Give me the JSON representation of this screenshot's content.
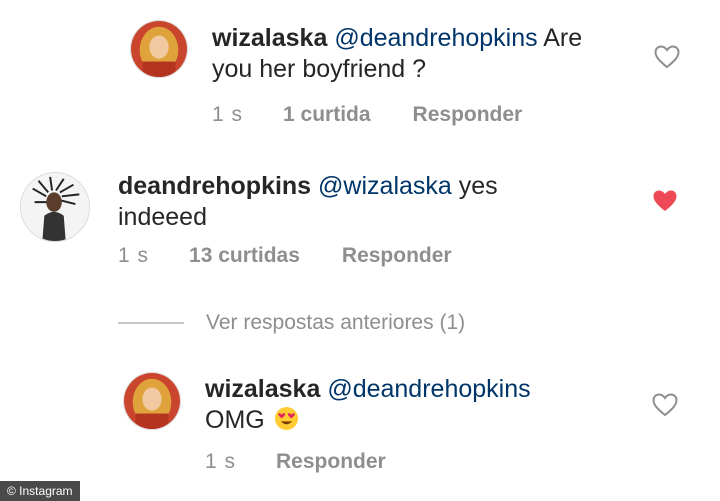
{
  "comments": [
    {
      "username": "wizalaska",
      "mention": "@deandrehopkins",
      "text_line1": "Are",
      "text_line2": "you her boyfriend ?",
      "time": "1 s",
      "likes": "1 curtida",
      "reply": "Responder",
      "liked": false
    },
    {
      "username": "deandrehopkins",
      "mention": "@wizalaska",
      "text_line1": "yes",
      "text_line2": "indeeed",
      "time": "1 s",
      "likes": "13 curtidas",
      "reply": "Responder",
      "liked": true
    },
    {
      "username": "wizalaska",
      "mention": "@deandrehopkins",
      "text_line2": "OMG",
      "emoji": "heart-eyes-emoji",
      "time": "1 s",
      "reply": "Responder",
      "liked": false
    }
  ],
  "view_previous": "Ver respostas anteriores (1)",
  "watermark": "© Instagram",
  "colors": {
    "liked_heart": "#ed4956",
    "mention": "#003569",
    "meta": "#8e8e8e"
  }
}
